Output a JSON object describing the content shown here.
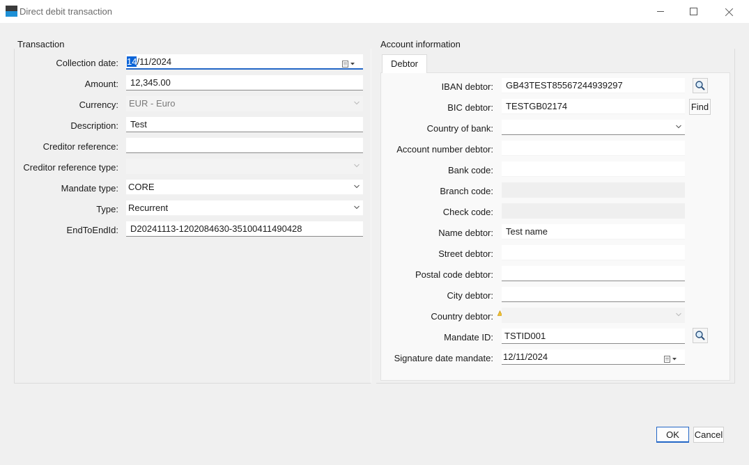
{
  "window": {
    "title": "Direct debit transaction"
  },
  "transaction": {
    "group_title": "Transaction",
    "collection_date": {
      "label": "Collection date:",
      "value_selected": "14",
      "value_rest": "/11/2024"
    },
    "amount": {
      "label": "Amount:",
      "value": "12,345.00"
    },
    "currency": {
      "label": "Currency:",
      "value": "EUR - Euro"
    },
    "description": {
      "label": "Description:",
      "value": "Test"
    },
    "creditor_reference": {
      "label": "Creditor reference:",
      "value": ""
    },
    "creditor_reference_type": {
      "label": "Creditor reference type:",
      "value": ""
    },
    "mandate_type": {
      "label": "Mandate type:",
      "value": "CORE"
    },
    "type": {
      "label": "Type:",
      "value": "Recurrent"
    },
    "end_to_end_id": {
      "label": "EndToEndId:",
      "value": "D20241113-1202084630-35100411490428"
    }
  },
  "account": {
    "group_title": "Account information",
    "tab_label": "Debtor",
    "iban": {
      "label": "IBAN debtor:",
      "value": "GB43TEST85567244939297"
    },
    "bic": {
      "label": "BIC debtor:",
      "value": "TESTGB02174",
      "find_label": "Find"
    },
    "country_of_bank": {
      "label": "Country of bank:",
      "value": ""
    },
    "account_number": {
      "label": "Account number debtor:",
      "value": ""
    },
    "bank_code": {
      "label": "Bank code:",
      "value": ""
    },
    "branch_code": {
      "label": "Branch code:",
      "value": ""
    },
    "check_code": {
      "label": "Check code:",
      "value": ""
    },
    "name": {
      "label": "Name debtor:",
      "value": "Test name"
    },
    "street": {
      "label": "Street debtor:",
      "value": ""
    },
    "postal_code": {
      "label": "Postal code debtor:",
      "value": ""
    },
    "city": {
      "label": "City debtor:",
      "value": ""
    },
    "country": {
      "label": "Country debtor:",
      "value": ""
    },
    "mandate_id": {
      "label": "Mandate ID:",
      "value": "TSTID001"
    },
    "signature_date": {
      "label": "Signature date mandate:",
      "value": "12/11/2024"
    }
  },
  "buttons": {
    "ok": "OK",
    "cancel": "Cancel"
  },
  "icons": {
    "app": "app-icon",
    "calendar": "calendar-icon",
    "lookup": "magnifier-icon",
    "warning": "warning-icon"
  },
  "colors": {
    "accent": "#2266c6",
    "selection": "#0a64d8",
    "background": "#f0f0f0"
  }
}
